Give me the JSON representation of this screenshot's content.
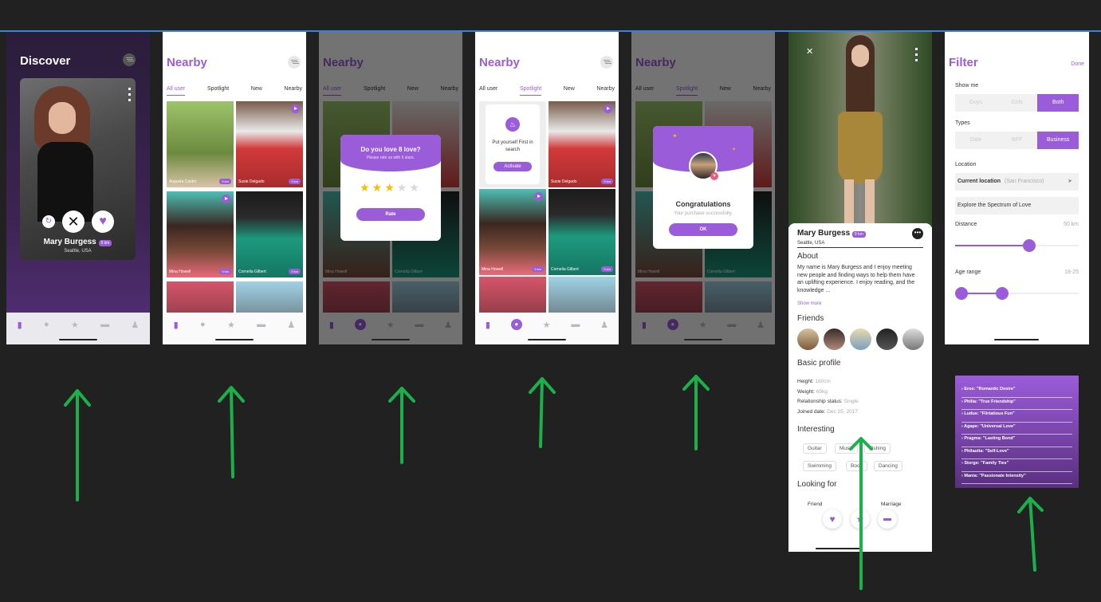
{
  "discover": {
    "title": "Discover",
    "name": "Mary Burgess",
    "badge": "9 km",
    "location": "Seattle, USA"
  },
  "nearby": {
    "title": "Nearby",
    "tabs": [
      "All user",
      "Spotlight",
      "New",
      "Nearby"
    ],
    "tiles": [
      {
        "name": "Augusta Castro",
        "badge": "9 km"
      },
      {
        "name": "Susie Delgado",
        "badge": "9 km"
      },
      {
        "name": "Mina Howell",
        "badge": "9 km"
      },
      {
        "name": "Cornelia Gilbert",
        "badge": "9 km"
      }
    ]
  },
  "rate": {
    "title": "Do you love 8 love?",
    "subtitle": "Please rate us with 5 stars.",
    "stars": 3,
    "button": "Rate"
  },
  "spotlight": {
    "text": "Put yourself First in search",
    "button": "Activate"
  },
  "congrats": {
    "title": "Congratulations",
    "subtitle": "Your purchase successfully.",
    "button": "OK"
  },
  "profile": {
    "name": "Mary Burgess",
    "badge": "9 km",
    "location": "Seattle, USA",
    "about_title": "About",
    "about": "My name is Mary Burgess and I enjoy meeting new people and finding ways to help them have an uplifting experience. I enjoy reading, and the knowledge ...",
    "show_more": "Show more",
    "friends_title": "Friends",
    "basic_title": "Basic profile",
    "height_label": "Height:",
    "height": "160cm",
    "weight_label": "Weight:",
    "weight": "65kg",
    "rel_label": "Relationship status:",
    "rel": "Single",
    "joined_label": "Joined date:",
    "joined": "Dec 25, 2017",
    "interesting_title": "Interesting",
    "tags": [
      "Guitar",
      "Music",
      "Fishing",
      "Swimming",
      "Book",
      "Dancing"
    ],
    "looking_title": "Looking for",
    "looking": [
      "Friend",
      "Marriage"
    ]
  },
  "filter": {
    "title": "Filter",
    "done": "Done",
    "show_me": "Show me",
    "show_opts": [
      "Guys",
      "Girls",
      "Both"
    ],
    "types": "Types",
    "type_opts": [
      "Date",
      "BFF",
      "Business"
    ],
    "location": "Location",
    "current_location": "Current location",
    "current_city": "(San Francisco)",
    "explore": "Explore the Spectrum of Love",
    "distance": "Distance",
    "distance_val": "50 km",
    "age": "Age range",
    "age_val": "18-25",
    "distance_fraction": 0.6,
    "age_low_fraction": 0.05,
    "age_high_fraction": 0.38
  },
  "love_types": [
    "Eros: \"Romantic Desire\"",
    "Philia: \"True Friendship\"",
    "Ludus: \"Flirtatious Fun\"",
    "Agape: \"Universal Love\"",
    "Pragma: \"Lasting Bond\"",
    "Philautia: \"Self-Love\"",
    "Storge: \"Family Ties\"",
    "Mania: \"Passionate Intensity\""
  ],
  "colors": {
    "accent": "#9b5cd9",
    "background": "#212121",
    "arrow": "#1ab04a"
  }
}
